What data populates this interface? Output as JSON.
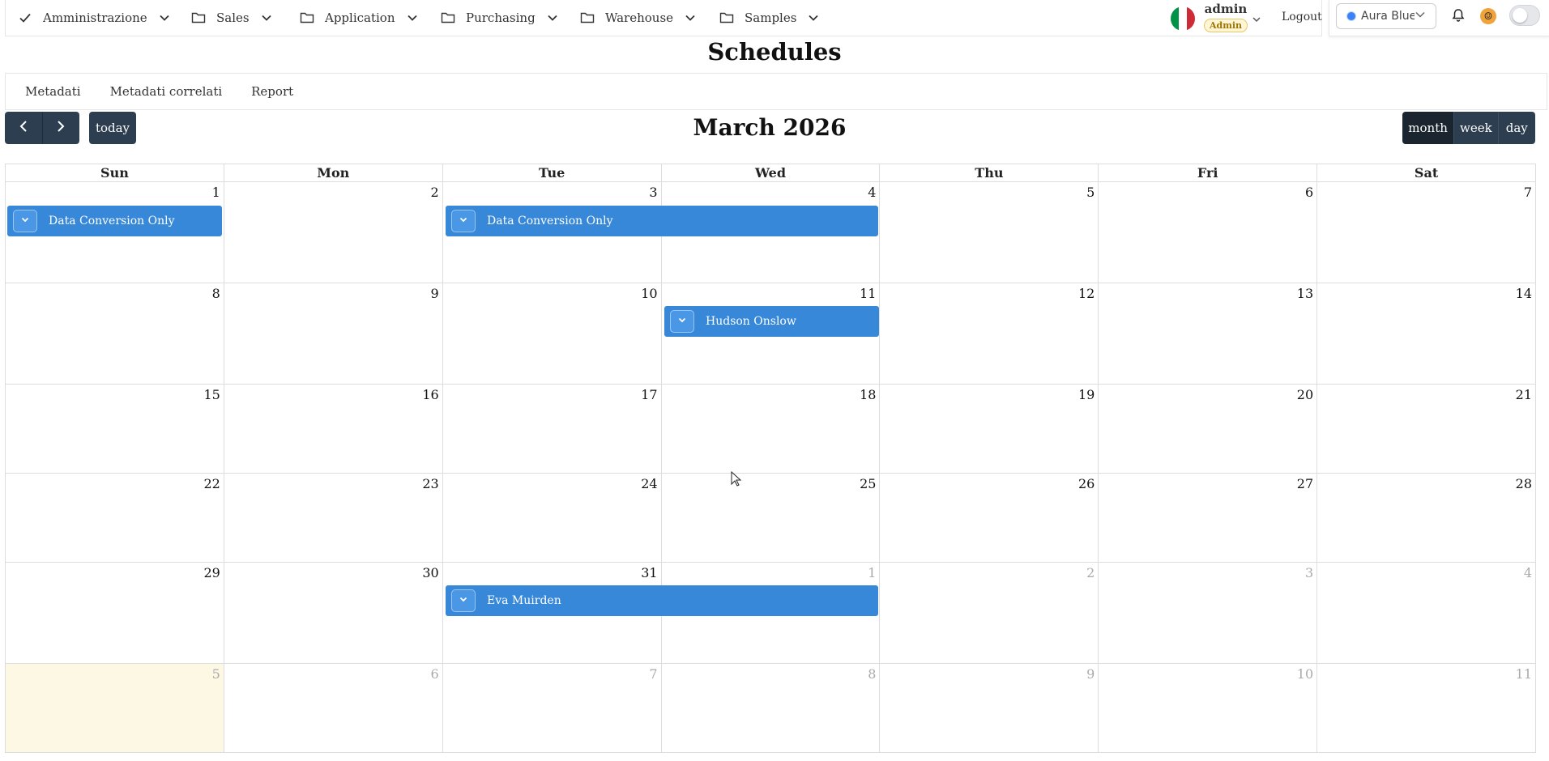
{
  "nav": {
    "menus": [
      {
        "label": "Amministrazione",
        "icon": "check-icon"
      },
      {
        "label": "Sales",
        "icon": "folder-icon"
      },
      {
        "label": "Application",
        "icon": "folder-icon"
      },
      {
        "label": "Purchasing",
        "icon": "folder-icon"
      },
      {
        "label": "Warehouse",
        "icon": "folder-icon"
      },
      {
        "label": "Samples",
        "icon": "folder-icon"
      }
    ],
    "user": {
      "name": "admin",
      "role": "Admin"
    },
    "logout_label": "Logout",
    "theme_label": "Aura Blue",
    "flag_colors": [
      "#009246",
      "#ffffff",
      "#ce2b37"
    ]
  },
  "page": {
    "title": "Schedules"
  },
  "subtabs": [
    "Metadati",
    "Metadati correlati",
    "Report"
  ],
  "calendar": {
    "title": "March 2026",
    "today_label": "today",
    "views": [
      "month",
      "week",
      "day"
    ],
    "active_view": "month",
    "weekdays": [
      "Sun",
      "Mon",
      "Tue",
      "Wed",
      "Thu",
      "Fri",
      "Sat"
    ],
    "weeks": [
      [
        "1",
        "2",
        "3",
        "4",
        "5",
        "6",
        "7"
      ],
      [
        "8",
        "9",
        "10",
        "11",
        "12",
        "13",
        "14"
      ],
      [
        "15",
        "16",
        "17",
        "18",
        "19",
        "20",
        "21"
      ],
      [
        "22",
        "23",
        "24",
        "25",
        "26",
        "27",
        "28"
      ],
      [
        "29",
        "30",
        "31",
        "1",
        "2",
        "3",
        "4"
      ],
      [
        "5",
        "6",
        "7",
        "8",
        "9",
        "10",
        "11"
      ]
    ],
    "events": [
      {
        "title": "Data Conversion Only",
        "start": "2026-03-01",
        "end": "2026-03-01"
      },
      {
        "title": "Data Conversion Only",
        "start": "2026-03-03",
        "end": "2026-03-04"
      },
      {
        "title": "Hudson Onslow",
        "start": "2026-03-11",
        "end": "2026-03-11"
      },
      {
        "title": "Eva Muirden",
        "start": "2026-03-31",
        "end": "2026-04-01"
      }
    ],
    "event_color": "#3788d8",
    "today_highlight_color": "#fcf8e3"
  }
}
